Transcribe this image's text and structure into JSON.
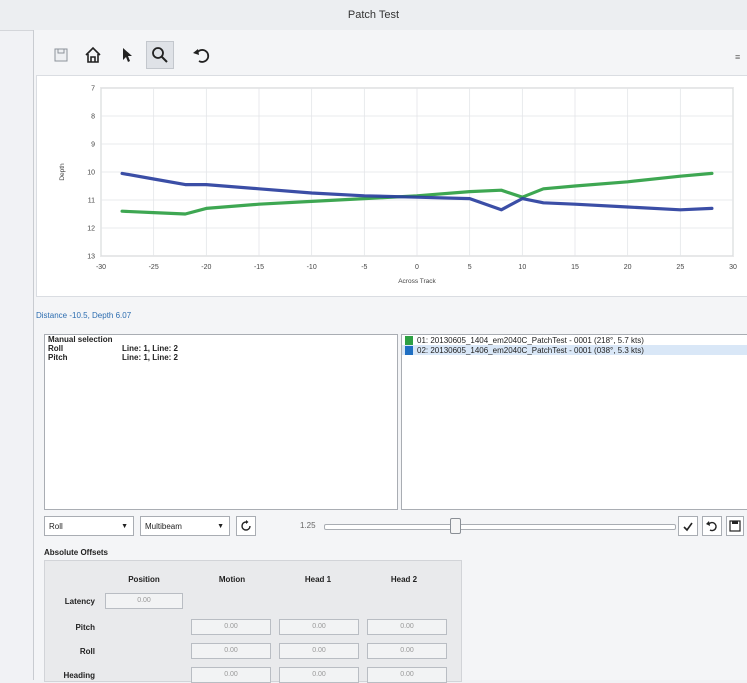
{
  "window": {
    "title": "Patch Test"
  },
  "toolbar": {
    "icons": [
      "save-icon",
      "home-icon",
      "pointer-icon",
      "zoom-icon",
      "undo-icon"
    ]
  },
  "status": "Distance -10.5, Depth 6.07",
  "chart_data": {
    "type": "line",
    "xlabel": "Across Track",
    "ylabel": "Depth",
    "xlim": [
      -30,
      30
    ],
    "ylim": [
      13,
      7
    ],
    "x_ticks": [
      "-30",
      "-25",
      "-20",
      "-15",
      "-10",
      "-5",
      "0",
      "5",
      "10",
      "15",
      "20",
      "25",
      "30"
    ],
    "y_ticks": [
      "7",
      "8",
      "9",
      "10",
      "11",
      "12",
      "13"
    ],
    "grid": true,
    "series": [
      {
        "color": "#2ea043",
        "x": [
          -28,
          -25,
          -22,
          -20,
          -15,
          -10,
          -5,
          0,
          5,
          8,
          10,
          12,
          15,
          20,
          25,
          28
        ],
        "y": [
          11.4,
          11.45,
          11.5,
          11.3,
          11.15,
          11.05,
          10.95,
          10.85,
          10.7,
          10.65,
          10.9,
          10.6,
          10.5,
          10.35,
          10.15,
          10.05
        ]
      },
      {
        "color": "#2a3f9e",
        "x": [
          -28,
          -25,
          -22,
          -20,
          -15,
          -10,
          -5,
          0,
          5,
          8,
          10,
          12,
          15,
          20,
          25,
          28
        ],
        "y": [
          10.05,
          10.25,
          10.45,
          10.45,
          10.6,
          10.75,
          10.85,
          10.9,
          10.95,
          11.35,
          10.95,
          11.1,
          11.15,
          11.25,
          11.35,
          11.3
        ]
      }
    ]
  },
  "selection_panel": {
    "header": "Manual selection",
    "rows": [
      {
        "key": "Roll",
        "value": "Line: 1, Line: 2"
      },
      {
        "key": "Pitch",
        "value": "Line: 1, Line: 2"
      }
    ]
  },
  "lines_panel": {
    "items": [
      {
        "label": "01: 20130605_1404_em2040C_PatchTest - 0001 (218°, 5.7 kts)",
        "color": "#2ea043"
      },
      {
        "label": "02: 20130605_1406_em2040C_PatchTest - 0001 (038°, 5.3 kts)",
        "color": "#1f6fc2"
      }
    ]
  },
  "controls": {
    "mode": "Roll",
    "sensor": "Multibeam",
    "slider_label": "1.25",
    "slider_value": 0.37
  },
  "offsets": {
    "title": "Absolute Offsets",
    "columns": [
      "Position",
      "Motion",
      "Head 1",
      "Head 2"
    ],
    "rows": [
      {
        "label": "Latency",
        "values": [
          "0.00"
        ]
      },
      {
        "label": "Pitch",
        "values": [
          "0.00",
          "0.00",
          "0.00"
        ]
      },
      {
        "label": "Roll",
        "values": [
          "0.00",
          "0.00",
          "0.00"
        ]
      },
      {
        "label": "Heading",
        "values": [
          "0.00",
          "0.00",
          "0.00"
        ]
      }
    ]
  }
}
